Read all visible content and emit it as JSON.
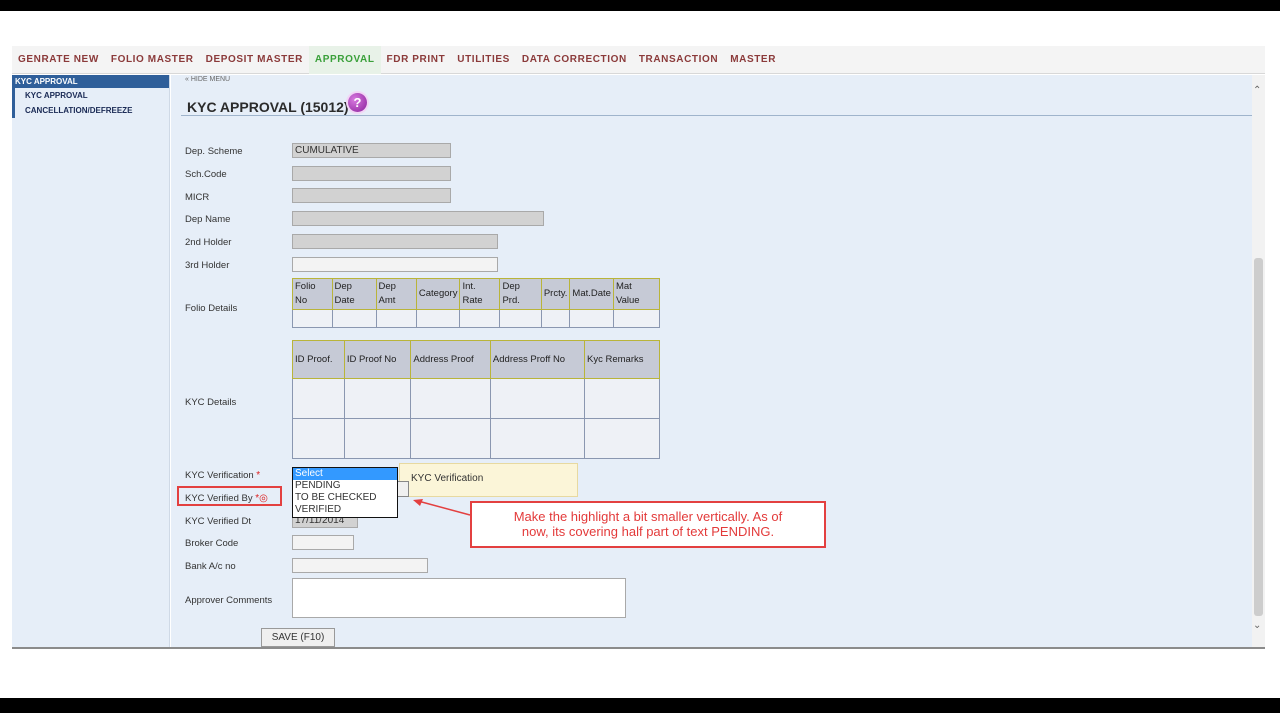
{
  "menu": [
    {
      "label": "GENRATE NEW"
    },
    {
      "label": "FOLIO MASTER"
    },
    {
      "label": "DEPOSIT MASTER"
    },
    {
      "label": "APPROVAL"
    },
    {
      "label": "FDR PRINT"
    },
    {
      "label": "UTILITIES"
    },
    {
      "label": "DATA CORRECTION"
    },
    {
      "label": "TRANSACTION"
    },
    {
      "label": "MASTER"
    }
  ],
  "sidebar": {
    "header": "KYC APPROVAL",
    "items": [
      {
        "label": "KYC APPROVAL"
      },
      {
        "label": "CANCELLATION/DEFREEZE"
      }
    ]
  },
  "main": {
    "hide_menu": "« HIDE MENU",
    "title": "KYC APPROVAL (15012)",
    "help_glyph": "?"
  },
  "form": {
    "dep_scheme_label": "Dep. Scheme",
    "dep_scheme_value": "CUMULATIVE",
    "sch_code_label": "Sch.Code",
    "sch_code_value": "",
    "micr_label": "MICR",
    "micr_value": "",
    "dep_name_label": "Dep Name",
    "dep_name_value": "",
    "second_holder_label": "2nd Holder",
    "second_holder_value": "",
    "third_holder_label": "3rd Holder",
    "third_holder_value": "",
    "folio_details_label": "Folio Details",
    "kyc_details_label": "KYC Details",
    "kyc_verification_label": "KYC Verification",
    "kyc_verified_by_label": "KYC Verified By",
    "kyc_verified_dt_label": "KYC Verified Dt",
    "kyc_verified_dt_value": "17/11/2014",
    "broker_code_label": "Broker Code",
    "broker_code_value": "",
    "bank_ac_label": "Bank A/c no",
    "bank_ac_value": "",
    "approver_comments_label": "Approver Comments",
    "required_mark": "*",
    "save_label": "SAVE (F10)"
  },
  "folio_table": {
    "headers": [
      "Folio No",
      "Dep Date",
      "Dep Amt",
      "Category",
      "Int. Rate",
      "Dep Prd.",
      "Prcty.",
      "Mat.Date",
      "Mat Value"
    ],
    "row": [
      "",
      "",
      "",
      "",
      "",
      "",
      "",
      "",
      ""
    ]
  },
  "kyc_table": {
    "headers": [
      "ID Proof.",
      "ID Proof No",
      "Address Proof",
      "Address Proff No",
      "Kyc Remarks"
    ],
    "rows": [
      [
        "",
        "",
        "",
        "",
        ""
      ],
      [
        "",
        "",
        "",
        "",
        ""
      ]
    ]
  },
  "kyc_verification_select": {
    "options": [
      "Select",
      "PENDING",
      "TO BE CHECKED",
      "VERIFIED"
    ],
    "selected_index": 0
  },
  "tooltip": "KYC Verification",
  "annotation": {
    "text_line1": "Make the highlight a bit smaller vertically. As of",
    "text_line2": "now, its covering half part of text PENDING.",
    "color": "#e34040"
  }
}
